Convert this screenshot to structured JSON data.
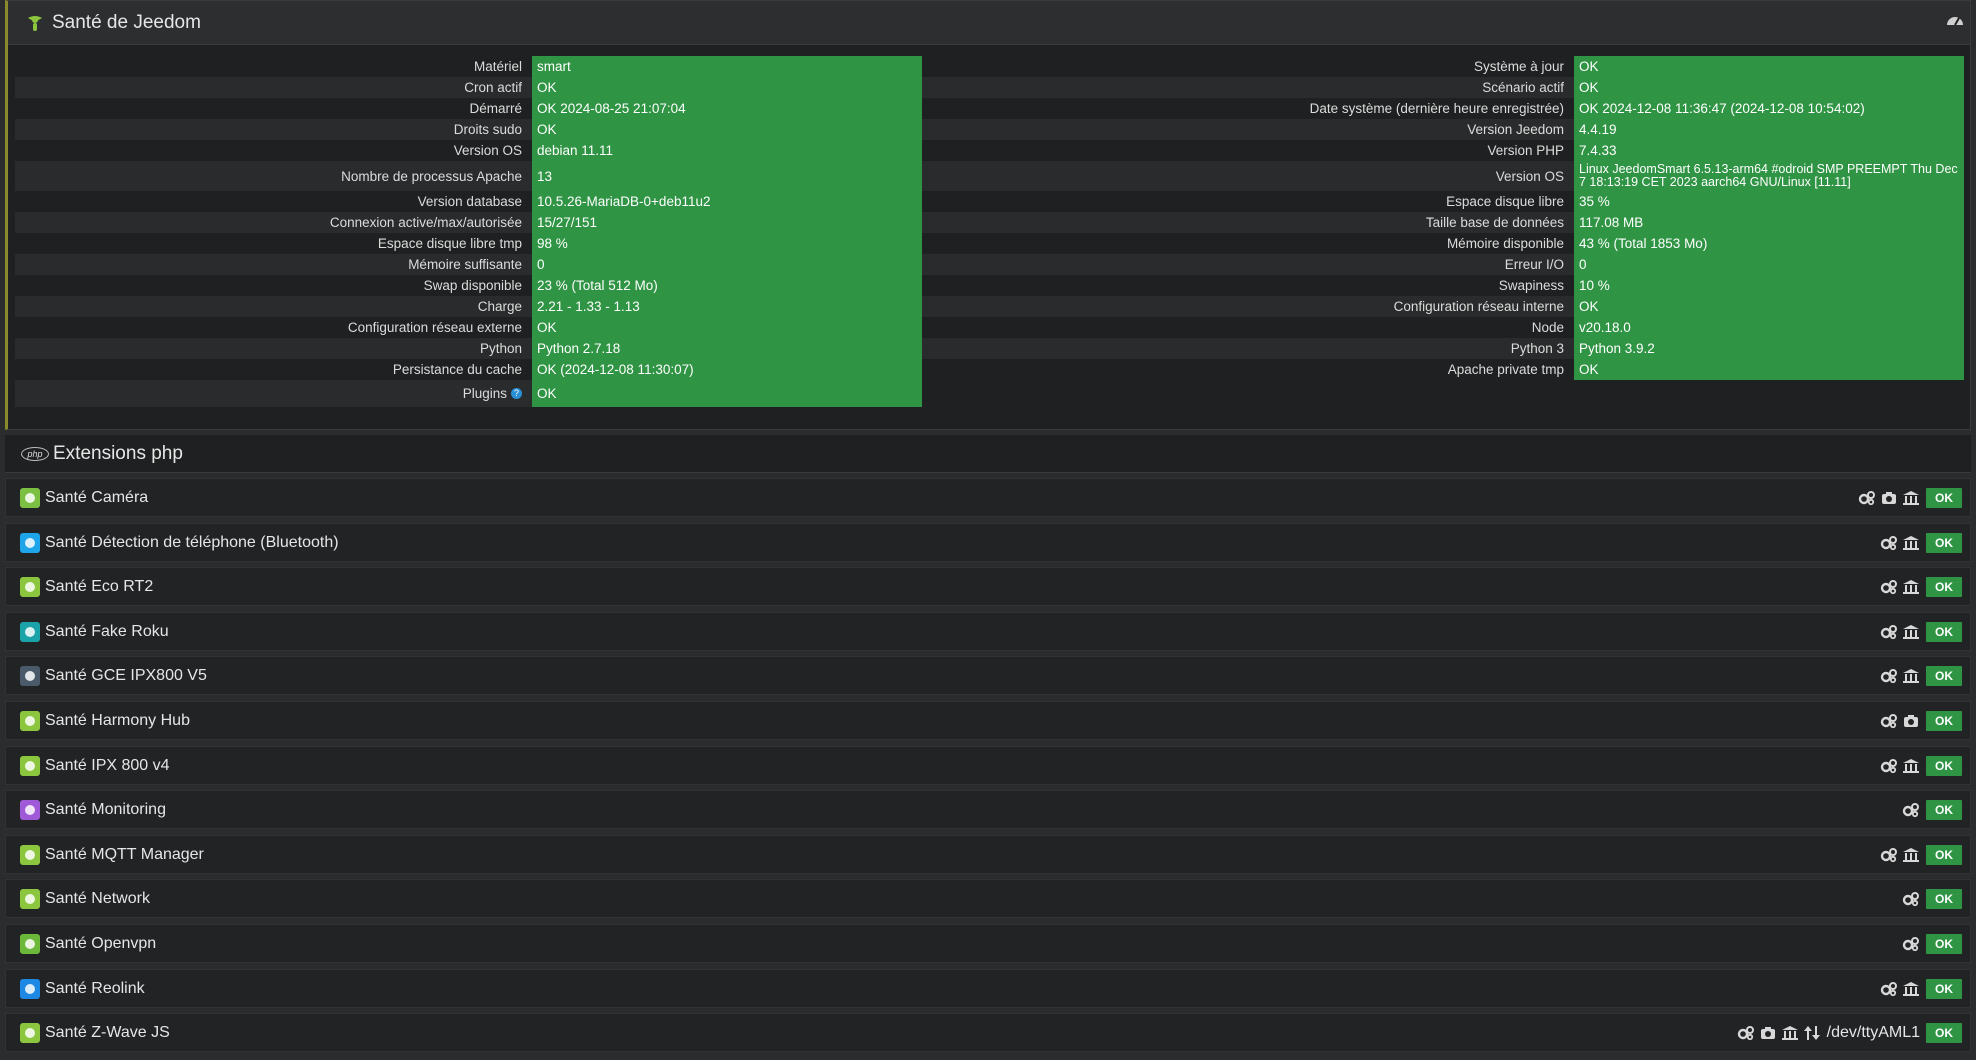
{
  "health": {
    "title": "Santé de Jeedom",
    "left": [
      {
        "label": "Matériel",
        "value": "smart"
      },
      {
        "label": "Cron actif",
        "value": "OK"
      },
      {
        "label": "Démarré",
        "value": "OK 2024-08-25 21:07:04"
      },
      {
        "label": "Droits sudo",
        "value": "OK"
      },
      {
        "label": "Version OS",
        "value": "debian 11.11"
      },
      {
        "label": "Nombre de processus Apache",
        "value": "13"
      },
      {
        "label": "Version database",
        "value": "10.5.26-MariaDB-0+deb11u2"
      },
      {
        "label": "Connexion active/max/autorisée",
        "value": "15/27/151"
      },
      {
        "label": "Espace disque libre tmp",
        "value": "98 %"
      },
      {
        "label": "Mémoire suffisante",
        "value": "0"
      },
      {
        "label": "Swap disponible",
        "value": "23 % (Total 512 Mo)"
      },
      {
        "label": "Charge",
        "value": "2.21 - 1.33 - 1.13"
      },
      {
        "label": "Configuration réseau externe",
        "value": "OK"
      },
      {
        "label": "Python",
        "value": "Python 2.7.18"
      },
      {
        "label": "Persistance du cache",
        "value": "OK (2024-12-08 11:30:07)"
      },
      {
        "label": "Plugins",
        "value": "OK"
      }
    ],
    "right": [
      {
        "label": "Système à jour",
        "value": "OK"
      },
      {
        "label": "Scénario actif",
        "value": "OK"
      },
      {
        "label": "Date système (dernière heure enregistrée)",
        "value": "OK 2024-12-08 11:36:47 (2024-12-08 10:54:02)"
      },
      {
        "label": "Version Jeedom",
        "value": "4.4.19"
      },
      {
        "label": "Version PHP",
        "value": "7.4.33"
      },
      {
        "label": "Version OS",
        "value": "Linux JeedomSmart 6.5.13-arm64 #odroid SMP PREEMPT Thu Dec 7 18:13:19 CET 2023 aarch64 GNU/Linux [11.11]"
      },
      {
        "label": "Espace disque libre",
        "value": "35 %"
      },
      {
        "label": "Taille base de données",
        "value": "117.08 MB"
      },
      {
        "label": "Mémoire disponible",
        "value": "43 % (Total 1853 Mo)"
      },
      {
        "label": "Erreur I/O",
        "value": "0"
      },
      {
        "label": "Swapiness",
        "value": "10 %"
      },
      {
        "label": "Configuration réseau interne",
        "value": "OK"
      },
      {
        "label": "Node",
        "value": "v20.18.0"
      },
      {
        "label": "Python 3",
        "value": "Python 3.9.2"
      },
      {
        "label": "Apache private tmp",
        "value": "OK"
      }
    ],
    "plugins_info_icon": "question-icon"
  },
  "php_section": {
    "title": "Extensions php",
    "logo_text": "php"
  },
  "plugins": [
    {
      "name": "Santé Caméra",
      "color": "#7bc043",
      "icons": [
        "gears-icon",
        "camera-icon",
        "bank-icon"
      ],
      "status": "OK"
    },
    {
      "name": "Santé Détection de téléphone (Bluetooth)",
      "color": "#1ea4e8",
      "icons": [
        "gears-icon",
        "bank-icon"
      ],
      "status": "OK"
    },
    {
      "name": "Santé Eco RT2",
      "color": "#8cc63f",
      "icons": [
        "gears-icon",
        "bank-icon"
      ],
      "status": "OK"
    },
    {
      "name": "Santé Fake Roku",
      "color": "#1aa3a8",
      "icons": [
        "gears-icon",
        "bank-icon"
      ],
      "status": "OK"
    },
    {
      "name": "Santé GCE IPX800 V5",
      "color": "#4a5a6a",
      "icons": [
        "gears-icon",
        "bank-icon"
      ],
      "status": "OK"
    },
    {
      "name": "Santé Harmony Hub",
      "color": "#8cc63f",
      "icons": [
        "gears-icon",
        "camera-icon"
      ],
      "status": "OK"
    },
    {
      "name": "Santé IPX 800 v4",
      "color": "#8cc63f",
      "icons": [
        "gears-icon",
        "bank-icon"
      ],
      "status": "OK"
    },
    {
      "name": "Santé Monitoring",
      "color": "#a05ad8",
      "icons": [
        "gears-icon"
      ],
      "status": "OK"
    },
    {
      "name": "Santé MQTT Manager",
      "color": "#8cc63f",
      "icons": [
        "gears-icon",
        "bank-icon"
      ],
      "status": "OK"
    },
    {
      "name": "Santé Network",
      "color": "#8cc63f",
      "icons": [
        "gears-icon"
      ],
      "status": "OK"
    },
    {
      "name": "Santé Openvpn",
      "color": "#6cb83a",
      "icons": [
        "gears-icon"
      ],
      "status": "OK"
    },
    {
      "name": "Santé Reolink",
      "color": "#1e88e5",
      "icons": [
        "gears-icon",
        "bank-icon"
      ],
      "status": "OK"
    },
    {
      "name": "Santé Z-Wave JS",
      "color": "#8cc63f",
      "icons": [
        "gears-icon",
        "camera-icon",
        "bank-icon",
        "sort-icon"
      ],
      "dev": "/dev/ttyAML1",
      "status": "OK"
    }
  ]
}
